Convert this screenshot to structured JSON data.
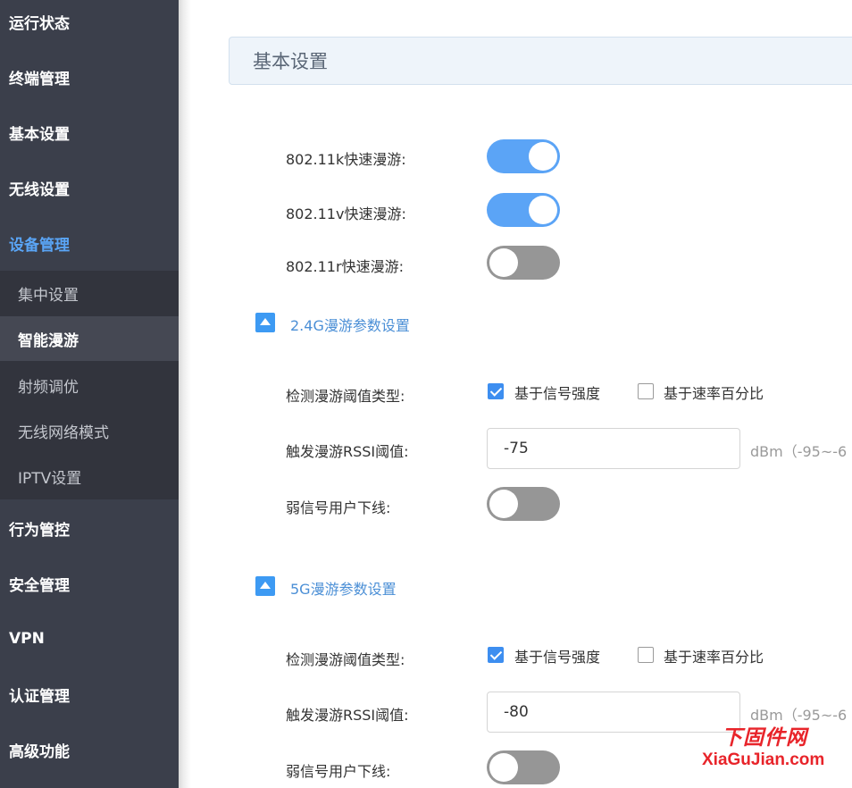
{
  "sidebar": {
    "items": [
      {
        "label": "运行状态"
      },
      {
        "label": "终端管理"
      },
      {
        "label": "基本设置"
      },
      {
        "label": "无线设置"
      },
      {
        "label": "设备管理"
      },
      {
        "label": "行为管控"
      },
      {
        "label": "安全管理"
      },
      {
        "label": "VPN"
      },
      {
        "label": "认证管理"
      },
      {
        "label": "高级功能"
      }
    ],
    "active_item": "设备管理",
    "sub_items": [
      {
        "label": "集中设置"
      },
      {
        "label": "智能漫游"
      },
      {
        "label": "射频调优"
      },
      {
        "label": "无线网络模式"
      },
      {
        "label": "IPTV设置"
      }
    ],
    "active_sub_item": "智能漫游"
  },
  "panel": {
    "title": "基本设置",
    "roaming": [
      {
        "label": "802.11k快速漫游:",
        "enabled": true
      },
      {
        "label": "802.11v快速漫游:",
        "enabled": true
      },
      {
        "label": "802.11r快速漫游:",
        "enabled": false
      }
    ],
    "sections": [
      {
        "title": "2.4G漫游参数设置",
        "expanded": true,
        "threshold_type_label": "检测漫游阈值类型:",
        "options": [
          {
            "label": "基于信号强度",
            "checked": true
          },
          {
            "label": "基于速率百分比",
            "checked": false
          }
        ],
        "rssi_label": "触发漫游RSSI阈值:",
        "rssi_value": "-75",
        "rssi_unit": "dBm（-95~-6",
        "weak_signal_label": "弱信号用户下线:",
        "weak_signal_enabled": false
      },
      {
        "title": "5G漫游参数设置",
        "expanded": true,
        "threshold_type_label": "检测漫游阈值类型:",
        "options": [
          {
            "label": "基于信号强度",
            "checked": true
          },
          {
            "label": "基于速率百分比",
            "checked": false
          }
        ],
        "rssi_label": "触发漫游RSSI阈值:",
        "rssi_value": "-80",
        "rssi_unit": "dBm（-95~-6",
        "weak_signal_label": "弱信号用户下线:",
        "weak_signal_enabled": false
      }
    ]
  },
  "watermark": {
    "line1": "下固件网",
    "line2": "XiaGuJian.com"
  },
  "colors": {
    "sidebar_bg": "#3b3f4b",
    "accent": "#5ba4f6",
    "toggle_off": "#969696",
    "watermark": "#e8242a"
  }
}
